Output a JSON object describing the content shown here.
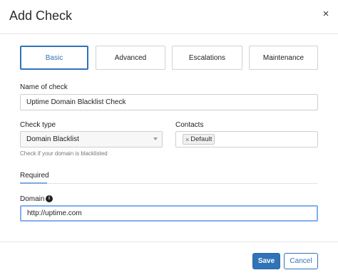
{
  "dialog": {
    "title": "Add Check",
    "close_glyph": "×"
  },
  "tabs": [
    {
      "label": "Basic",
      "active": true
    },
    {
      "label": "Advanced",
      "active": false
    },
    {
      "label": "Escalations",
      "active": false
    },
    {
      "label": "Maintenance",
      "active": false
    }
  ],
  "form": {
    "name_label": "Name of check",
    "name_value": "Uptime Domain Blacklist Check",
    "check_type_label": "Check type",
    "check_type_value": "Domain Blacklist",
    "check_type_help": "Check if your domain is blacklisted",
    "contacts_label": "Contacts",
    "contacts": [
      {
        "label": "Default",
        "remove_glyph": "×"
      }
    ],
    "section_tab": "Required",
    "domain_label": "Domain",
    "domain_info_glyph": "i",
    "domain_value": "http://uptime.com"
  },
  "footer": {
    "save_label": "Save",
    "cancel_label": "Cancel"
  },
  "colors": {
    "accent": "#2f73b8",
    "focus_border": "#82aef0"
  },
  "icons": {
    "close": "close-icon",
    "info": "info-icon",
    "caret": "chevron-down-icon",
    "token_remove": "remove-icon"
  }
}
